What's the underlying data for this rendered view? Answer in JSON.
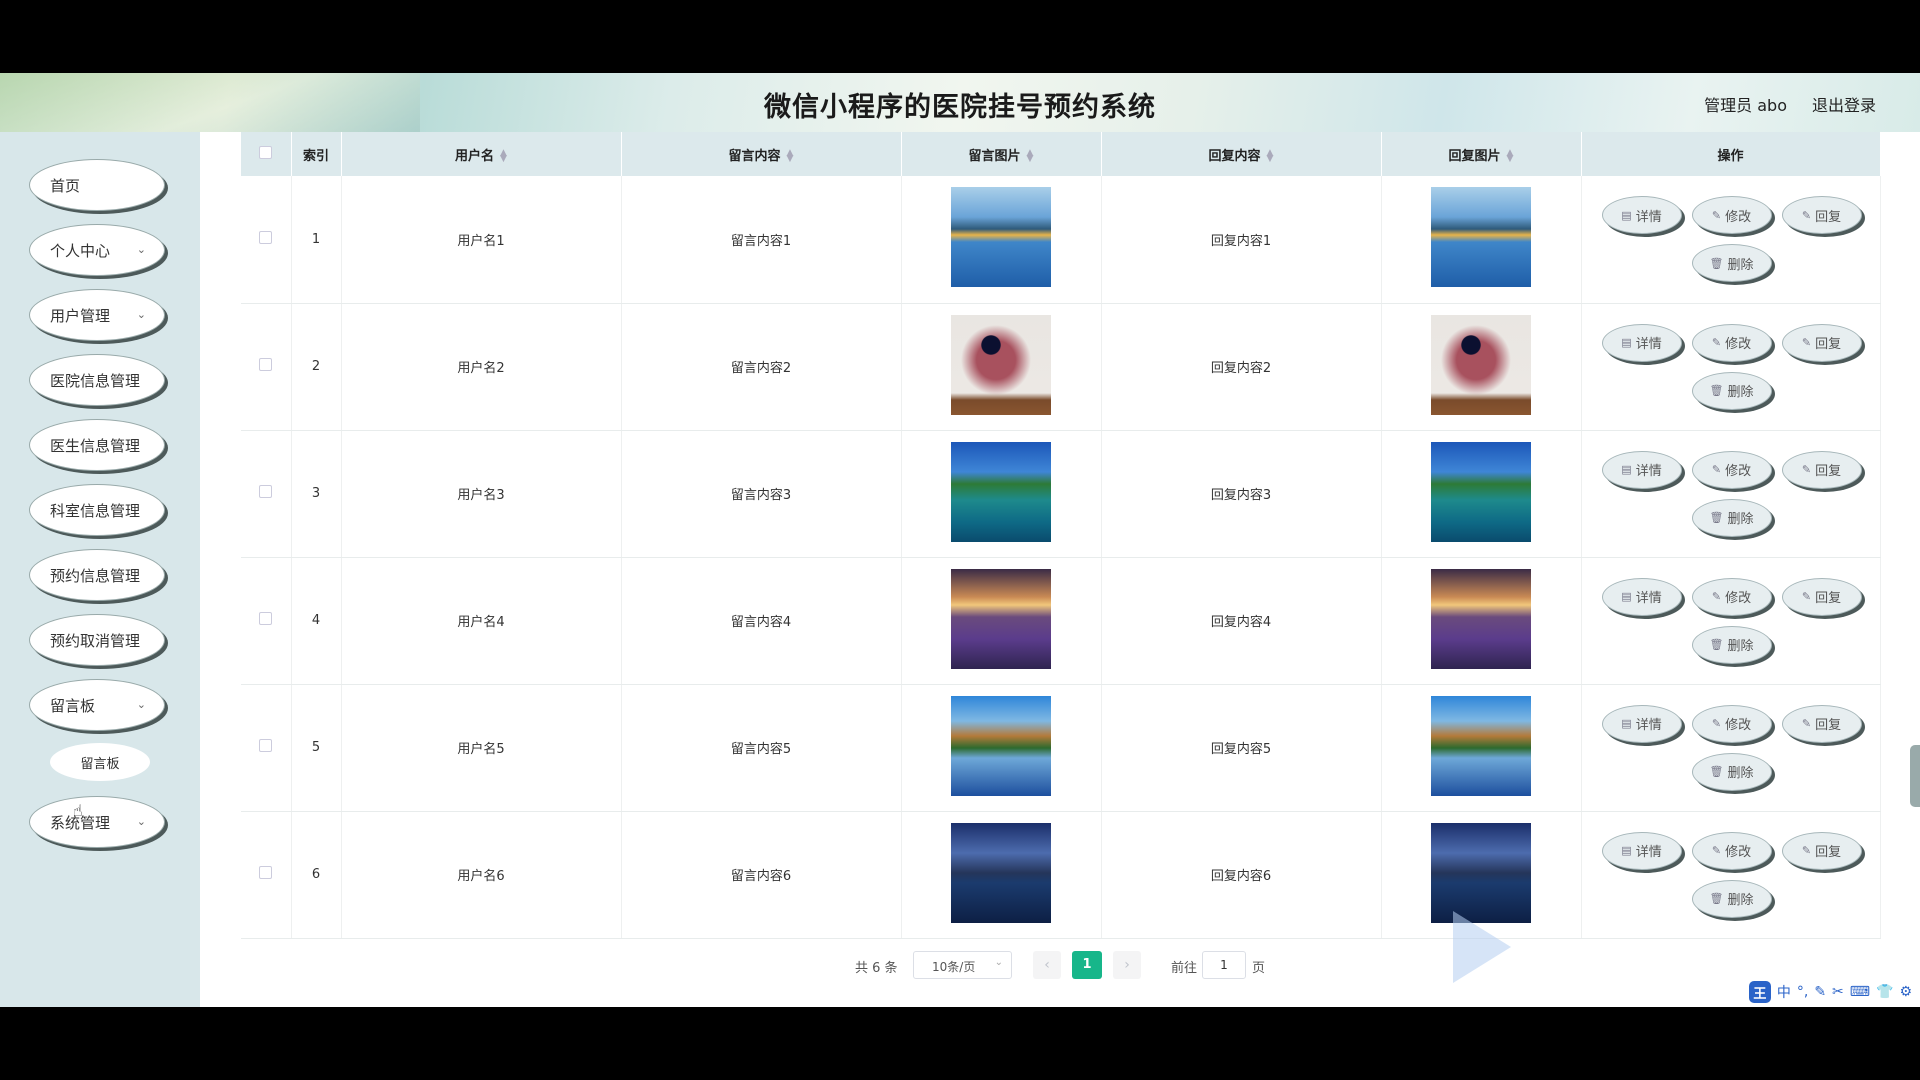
{
  "header": {
    "title": "微信小程序的医院挂号预约系统",
    "user": "管理员 abo",
    "logout": "退出登录"
  },
  "sidebar": {
    "items": [
      {
        "label": "首页",
        "expandable": false
      },
      {
        "label": "个人中心",
        "expandable": true
      },
      {
        "label": "用户管理",
        "expandable": true
      },
      {
        "label": "医院信息管理",
        "expandable": false
      },
      {
        "label": "医生信息管理",
        "expandable": false
      },
      {
        "label": "科室信息管理",
        "expandable": false
      },
      {
        "label": "预约信息管理",
        "expandable": false
      },
      {
        "label": "预约取消管理",
        "expandable": false
      },
      {
        "label": "留言板",
        "expandable": true
      },
      {
        "label": "系统管理",
        "expandable": true
      }
    ],
    "subitems": [
      {
        "label": "留言板"
      }
    ]
  },
  "table": {
    "columns": [
      "索引",
      "用户名",
      "留言内容",
      "留言图片",
      "回复内容",
      "回复图片",
      "操作"
    ],
    "rows": [
      {
        "index": "1",
        "username": "用户名1",
        "content": "留言内容1",
        "reply": "回复内容1",
        "image": "lake-tree-photo"
      },
      {
        "index": "2",
        "username": "用户名2",
        "content": "留言内容2",
        "reply": "回复内容2",
        "image": "pink-cloud-poster-photo"
      },
      {
        "index": "3",
        "username": "用户名3",
        "content": "留言内容3",
        "reply": "回复内容3",
        "image": "tropical-island-photo"
      },
      {
        "index": "4",
        "username": "用户名4",
        "content": "留言内容4",
        "reply": "回复内容4",
        "image": "lavender-field-photo"
      },
      {
        "index": "5",
        "username": "用户名5",
        "content": "留言内容5",
        "reply": "回复内容5",
        "image": "mountain-lake-photo"
      },
      {
        "index": "6",
        "username": "用户名6",
        "content": "留言内容6",
        "reply": "回复内容6",
        "image": "night-lake-photo"
      }
    ],
    "actions": {
      "detail": "详情",
      "edit": "修改",
      "reply": "回复",
      "delete": "删除"
    }
  },
  "pagination": {
    "total": "共 6 条",
    "page_size": "10条/页",
    "current": "1",
    "goto_label": "前往",
    "goto_value": "1",
    "page_unit": "页"
  },
  "tray": {
    "ime": "中"
  },
  "colors": {
    "accent": "#17b68a",
    "sidebar_bg": "#d8e7ea",
    "table_header_bg": "#dce9ec"
  }
}
